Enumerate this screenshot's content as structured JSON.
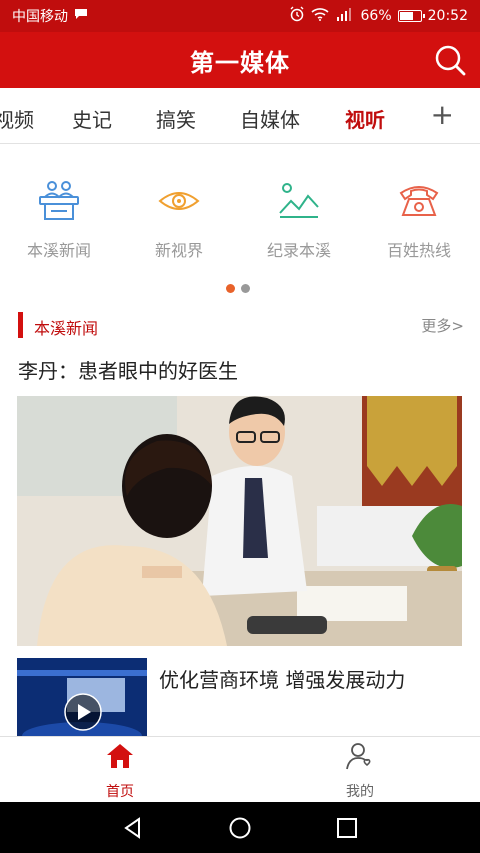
{
  "status_bar": {
    "carrier": "中国移动",
    "battery": "66%",
    "time": "20:52"
  },
  "app_bar": {
    "title": "第一媒体"
  },
  "tabs": [
    {
      "label": "视频"
    },
    {
      "label": "史记"
    },
    {
      "label": "搞笑"
    },
    {
      "label": "自媒体"
    },
    {
      "label": "视听",
      "active": true
    }
  ],
  "tab_add": "+",
  "shortcuts": [
    {
      "label": "本溪新闻",
      "icon": "podium-icon",
      "color": "#4a90d9"
    },
    {
      "label": "新视界",
      "icon": "eye-icon",
      "color": "#f0a030"
    },
    {
      "label": "纪录本溪",
      "icon": "landscape-icon",
      "color": "#2fb38a"
    },
    {
      "label": "百姓热线",
      "icon": "telephone-icon",
      "color": "#e8624a"
    }
  ],
  "carousel": {
    "page_count": 2,
    "active_page": 1
  },
  "section": {
    "name": "本溪新闻",
    "more": "更多>"
  },
  "headline": "李丹：患者眼中的好医生",
  "news_list": [
    {
      "title": "优化营商环境  增强发展动力",
      "icon": "play-icon"
    }
  ],
  "bottom_nav": [
    {
      "label": "首页",
      "icon": "home-icon",
      "active": true
    },
    {
      "label": "我的",
      "icon": "profile-icon"
    }
  ],
  "colors": {
    "brand_red": "#d3100f",
    "status_red": "#c00d0d",
    "active_dot": "#e8622a"
  }
}
